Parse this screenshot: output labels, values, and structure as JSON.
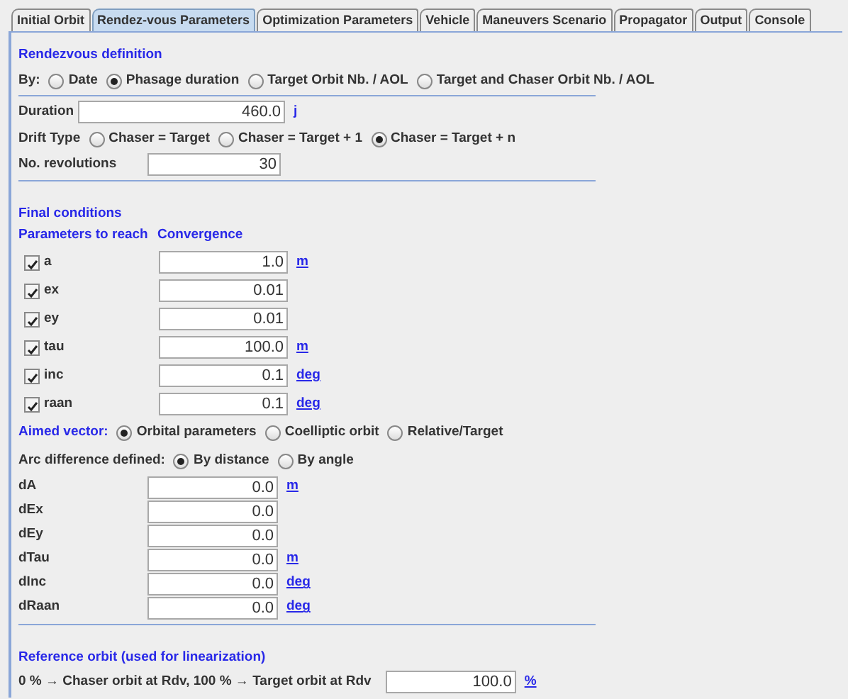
{
  "tabs": [
    {
      "label": "Initial Orbit",
      "selected": false
    },
    {
      "label": "Rendez-vous Parameters",
      "selected": true
    },
    {
      "label": "Optimization Parameters",
      "selected": false
    },
    {
      "label": "Vehicle",
      "selected": false
    },
    {
      "label": "Maneuvers Scenario",
      "selected": false
    },
    {
      "label": "Propagator",
      "selected": false
    },
    {
      "label": "Output",
      "selected": false
    },
    {
      "label": "Console",
      "selected": false
    }
  ],
  "rendezvous": {
    "title": "Rendezvous definition",
    "by_label": "By:",
    "by_options": [
      {
        "label": "Date",
        "selected": false
      },
      {
        "label": "Phasage duration",
        "selected": true
      },
      {
        "label": "Target Orbit Nb. / AOL",
        "selected": false
      },
      {
        "label": "Target and Chaser Orbit Nb. / AOL",
        "selected": false
      }
    ],
    "duration": {
      "label": "Duration",
      "value": "460.0",
      "unit": "j"
    },
    "drift_label": "Drift Type",
    "drift_options": [
      {
        "label": "Chaser = Target",
        "selected": false
      },
      {
        "label": "Chaser = Target + 1",
        "selected": false
      },
      {
        "label": "Chaser = Target + n",
        "selected": true
      }
    ],
    "revolutions": {
      "label": "No. revolutions",
      "value": "30"
    }
  },
  "final": {
    "title": "Final conditions",
    "col_params": "Parameters to reach",
    "col_convergence": "Convergence",
    "params": [
      {
        "name": "a",
        "checked": true,
        "value": "1.0",
        "unit": "m"
      },
      {
        "name": "ex",
        "checked": true,
        "value": "0.01"
      },
      {
        "name": "ey",
        "checked": true,
        "value": "0.01"
      },
      {
        "name": "tau",
        "checked": true,
        "value": "100.0",
        "unit": "m"
      },
      {
        "name": "inc",
        "checked": true,
        "value": "0.1",
        "unit": "deg"
      },
      {
        "name": "raan",
        "checked": true,
        "value": "0.1",
        "unit": "deg"
      }
    ],
    "aimed_label": "Aimed vector:",
    "aimed_options": [
      {
        "label": "Orbital parameters",
        "selected": true
      },
      {
        "label": "Coelliptic orbit",
        "selected": false
      },
      {
        "label": "Relative/Target",
        "selected": false
      }
    ],
    "arc_label": "Arc difference defined:",
    "arc_options": [
      {
        "label": "By distance",
        "selected": true
      },
      {
        "label": "By angle",
        "selected": false
      }
    ],
    "diffs": [
      {
        "name": "dA",
        "value": "0.0",
        "unit": "m"
      },
      {
        "name": "dEx",
        "value": "0.0"
      },
      {
        "name": "dEy",
        "value": "0.0"
      },
      {
        "name": "dTau",
        "value": "0.0",
        "unit": "m"
      },
      {
        "name": "dInc",
        "value": "0.0",
        "unit": "deg"
      },
      {
        "name": "dRaan",
        "value": "0.0",
        "unit": "deg"
      }
    ]
  },
  "reference": {
    "title": "Reference orbit (used for linearization)",
    "label": "0 % → Chaser orbit at Rdv,  100 % → Target orbit at Rdv",
    "value": "100.0",
    "unit": "%"
  }
}
